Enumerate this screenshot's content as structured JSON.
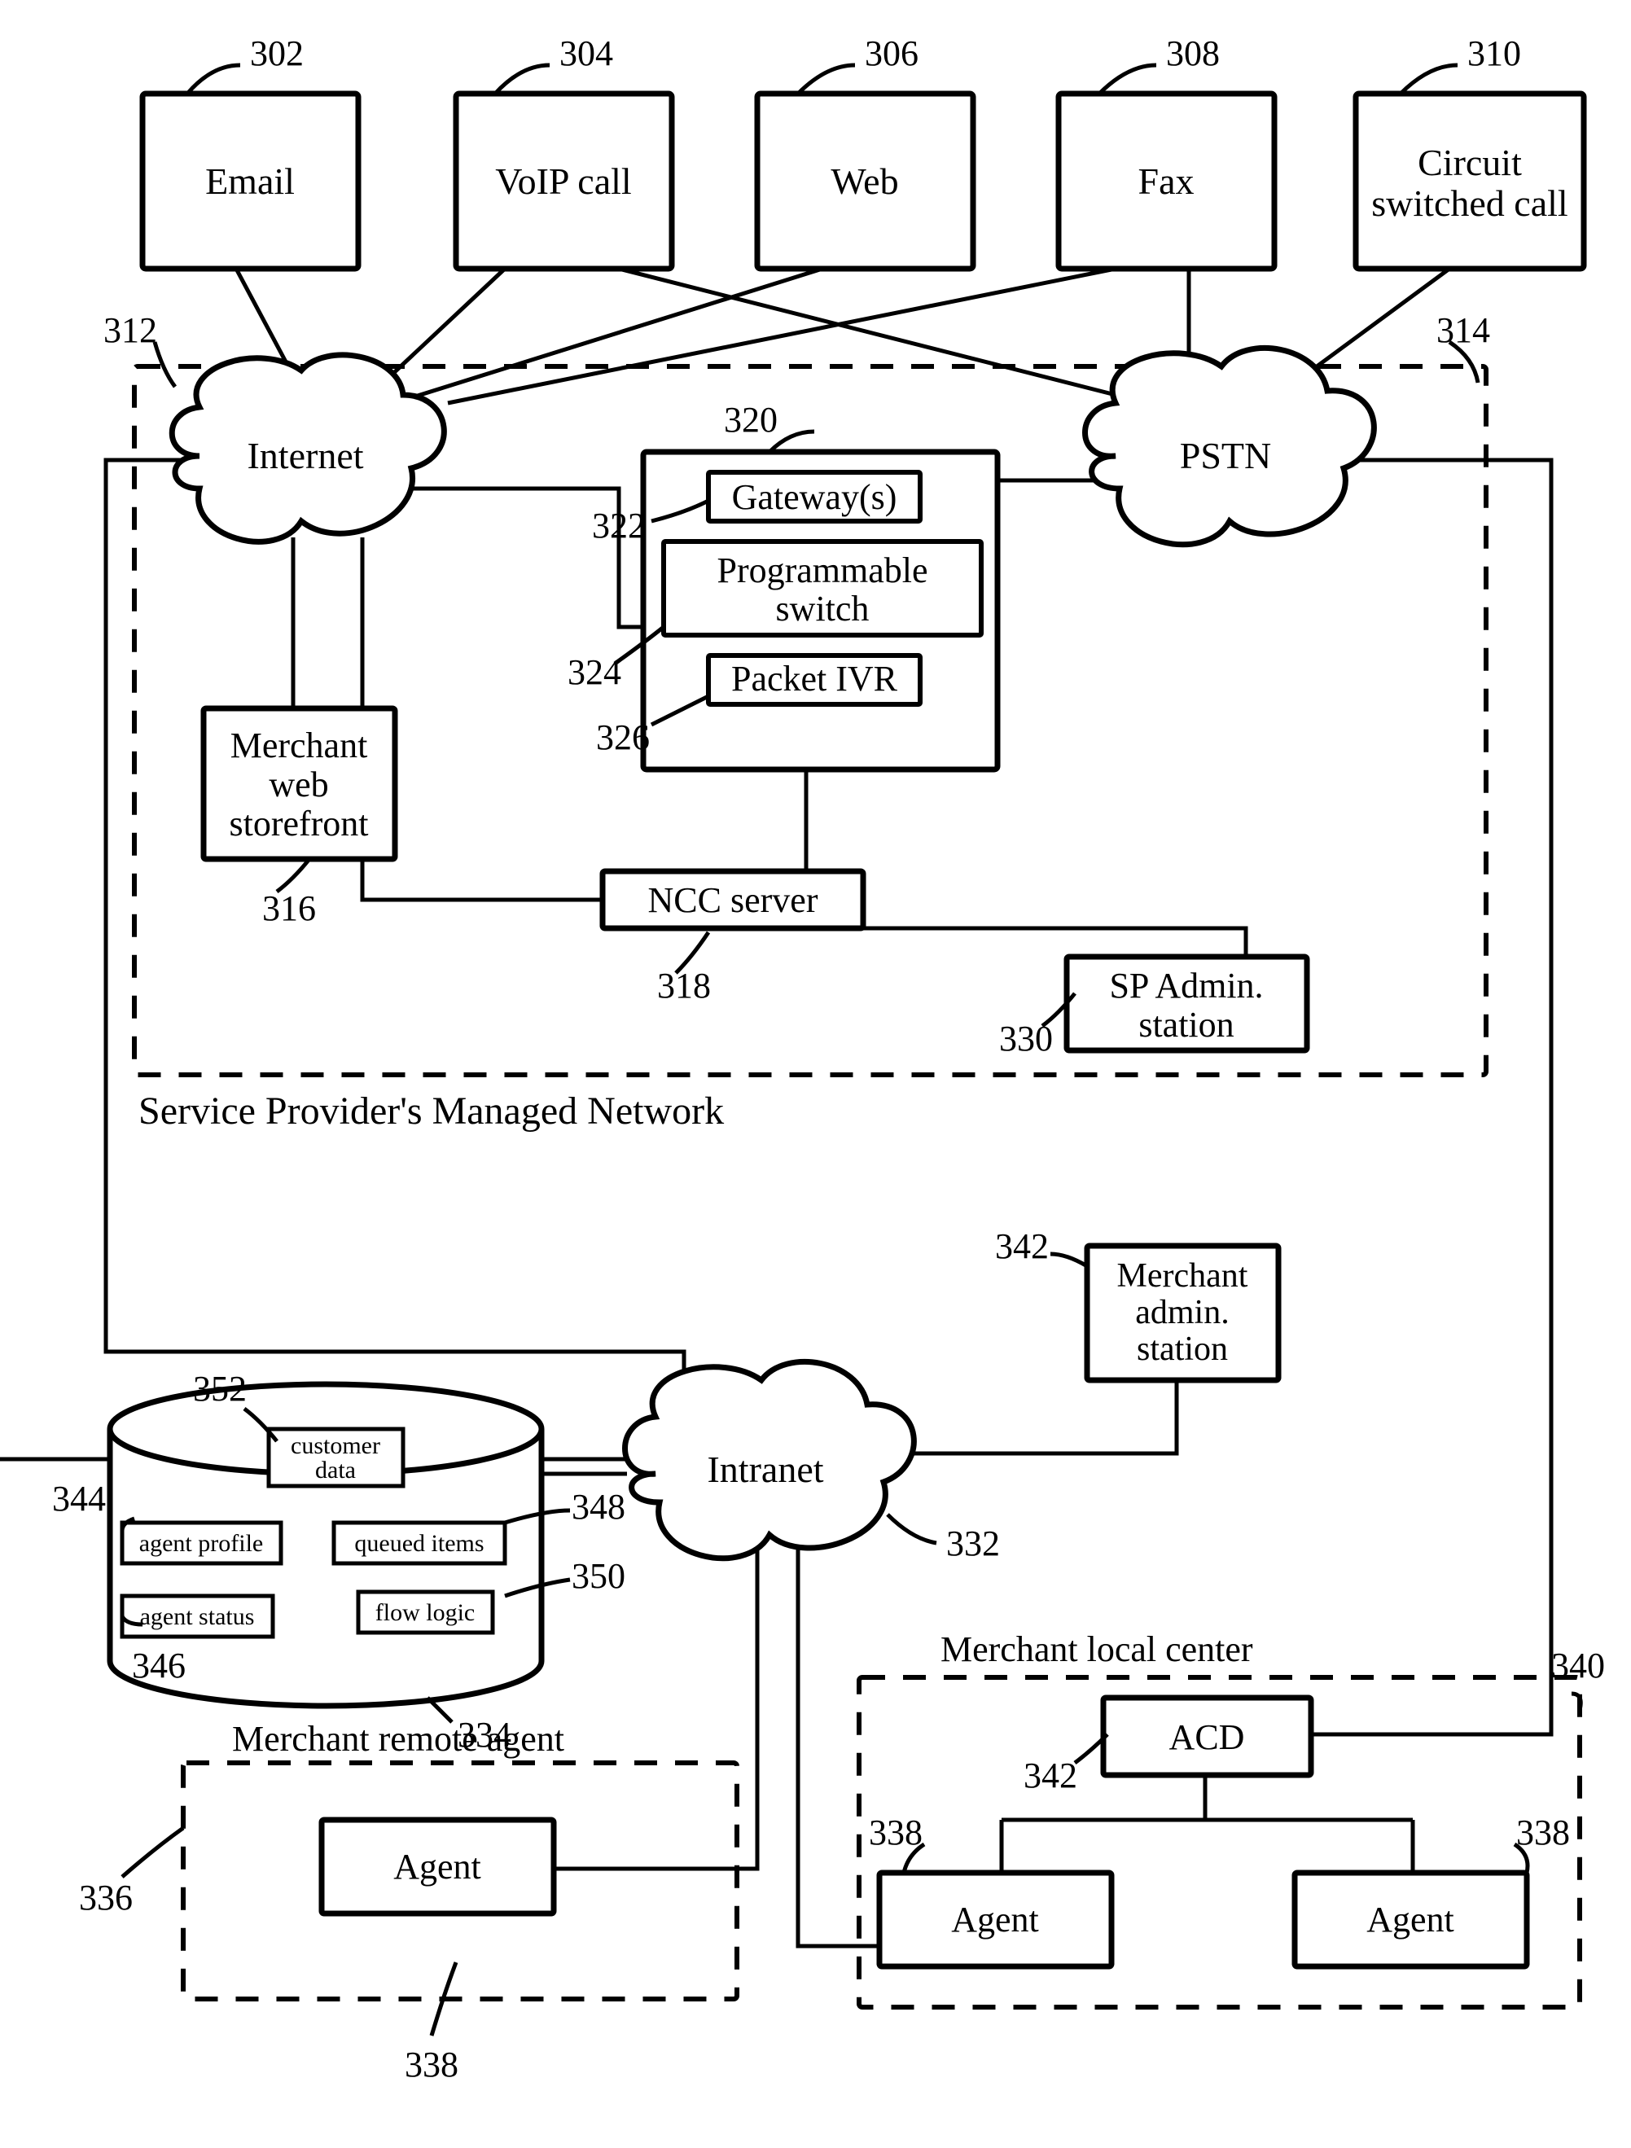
{
  "blocks": {
    "email": {
      "label": "Email",
      "ref": "302"
    },
    "voip": {
      "label": "VoIP call",
      "ref": "304"
    },
    "web": {
      "label": "Web",
      "ref": "306"
    },
    "fax": {
      "label": "Fax",
      "ref": "308"
    },
    "circuit": {
      "label1": "Circuit",
      "label2": "switched call",
      "ref": "310"
    },
    "internet": {
      "label": "Internet",
      "ref": "312"
    },
    "pstn": {
      "label": "PSTN",
      "ref": "314"
    },
    "intranet": {
      "label": "Intranet",
      "ref": "332"
    },
    "switchbox": {
      "ref": "320"
    },
    "gateway": {
      "label": "Gateway(s)",
      "ref": "322"
    },
    "progsw": {
      "label1": "Programmable",
      "label2": "switch",
      "ref": "324"
    },
    "packet": {
      "label": "Packet IVR",
      "ref": "326"
    },
    "ncc": {
      "label": "NCC server",
      "ref": "318"
    },
    "spadmin": {
      "label1": "SP Admin.",
      "label2": "station",
      "ref": "330"
    },
    "storefront": {
      "label1": "Merchant",
      "label2": "web",
      "label3": "storefront",
      "ref": "316"
    },
    "madmin": {
      "label1": "Merchant",
      "label2": "admin.",
      "label3": "station",
      "ref": "342"
    },
    "cylinder": {
      "ref": "334"
    },
    "cust": {
      "label1": "customer",
      "label2": "data",
      "ref": "352"
    },
    "aprofile": {
      "label": "agent profile",
      "ref": "344"
    },
    "astatus": {
      "label": "agent status",
      "ref": "346"
    },
    "qitems": {
      "label": "queued items",
      "ref": "348"
    },
    "flow": {
      "label": "flow logic",
      "ref": "350"
    },
    "acd": {
      "label": "ACD",
      "ref": "342"
    },
    "agent": {
      "label": "Agent",
      "ref": "338"
    }
  },
  "sections": {
    "sp": "Service Provider's Managed Network",
    "remote": {
      "label": "Merchant remote agent",
      "ref": "336"
    },
    "local": {
      "label": "Merchant local center",
      "ref": "340"
    }
  }
}
